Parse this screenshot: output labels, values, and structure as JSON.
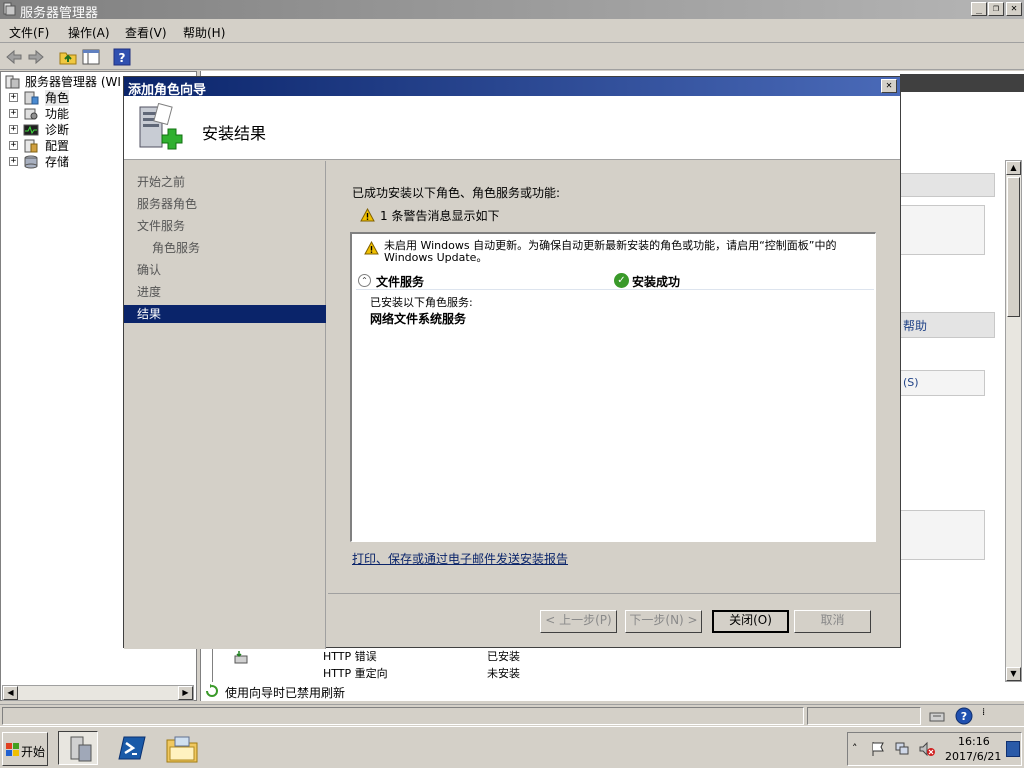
{
  "window": {
    "title": "服务器管理器",
    "buttons": {
      "minimize": "_",
      "restore": "❐",
      "close": "✕"
    }
  },
  "menu": {
    "items": [
      "文件(F)",
      "操作(A)",
      "查看(V)",
      "帮助(H)"
    ]
  },
  "tree": {
    "root_label": "服务器管理器 (WI",
    "items": [
      {
        "label": "角色",
        "icon": "roles-icon"
      },
      {
        "label": "功能",
        "icon": "features-icon"
      },
      {
        "label": "诊断",
        "icon": "diagnostics-icon"
      },
      {
        "label": "配置",
        "icon": "configuration-icon"
      },
      {
        "label": "存储",
        "icon": "storage-icon"
      }
    ]
  },
  "background": {
    "right_snippet_1": "帮助",
    "right_snippet_2": "(S)",
    "rows": [
      {
        "name": "HTTP 错误",
        "status": "已安装"
      },
      {
        "name": "HTTP 重定向",
        "status": "未安装"
      }
    ],
    "refresh_status": "使用向导时已禁用刷新"
  },
  "wizard": {
    "title": "添加角色向导",
    "header_title": "安装结果",
    "nav": [
      {
        "label": "开始之前",
        "sub": false,
        "active": false
      },
      {
        "label": "服务器角色",
        "sub": false,
        "active": false
      },
      {
        "label": "文件服务",
        "sub": false,
        "active": false
      },
      {
        "label": "角色服务",
        "sub": true,
        "active": false
      },
      {
        "label": "确认",
        "sub": false,
        "active": false
      },
      {
        "label": "进度",
        "sub": false,
        "active": false
      },
      {
        "label": "结果",
        "sub": false,
        "active": true
      }
    ],
    "success_text": "已成功安装以下角色、角色服务或功能:",
    "warning_summary": "1 条警告消息显示如下",
    "result": {
      "warning_text": "未启用 Windows 自动更新。为确保自动更新最新安装的角色或功能，请启用“控制面板”中的 Windows Update。",
      "role_name": "文件服务",
      "status": "安装成功",
      "installed_services_label": "已安装以下角色服务:",
      "service": "网络文件系统服务"
    },
    "report_link": "打印、保存或通过电子邮件发送安装报告",
    "buttons": {
      "prev": "< 上一步(P)",
      "next": "下一步(N) >",
      "close": "关闭(O)",
      "cancel": "取消"
    }
  },
  "taskbar": {
    "start_label": "开始",
    "time": "16:16",
    "date": "2017/6/21"
  },
  "colors": {
    "dialog_title": "#0a246a",
    "nav_active": "#0a246a",
    "success_green": "#3a9a2a",
    "warning_yellow": "#f0c000"
  }
}
